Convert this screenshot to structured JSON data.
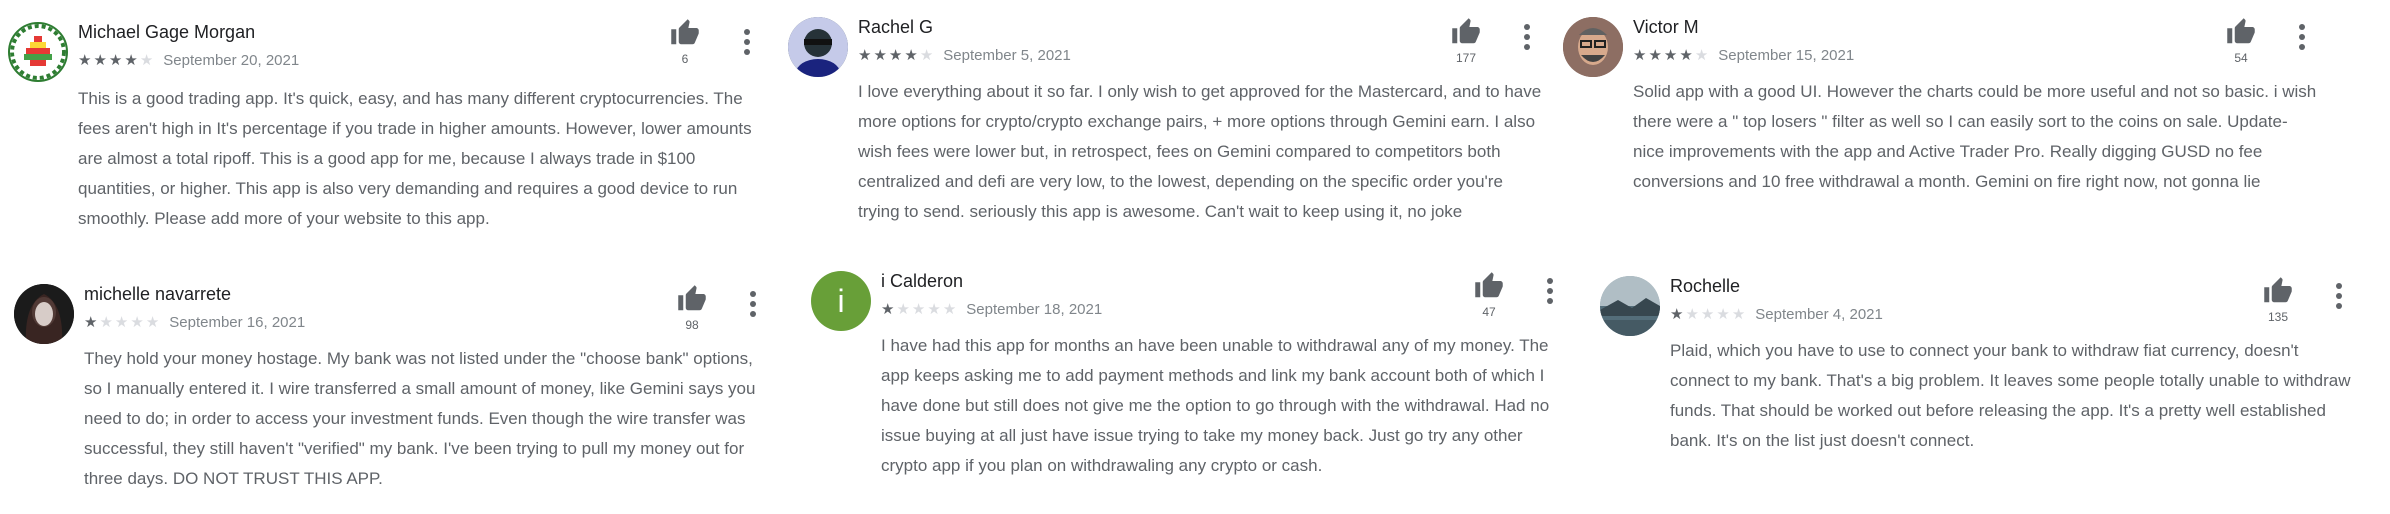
{
  "reviews": [
    {
      "name": "Michael Gage Morgan",
      "rating": 4,
      "date": "September 20, 2021",
      "helpful_count": "6",
      "avatar_icon": "pixel-art-avatar",
      "text": "This is a good trading app. It's quick, easy, and has many different cryptocurrencies. The fees aren't high in It's percentage if you trade in higher amounts. However, lower amounts are almost a total ripoff. This is a good app for me, because I always trade in $100 quantities, or higher. This app is also very demanding and requires a good device to run smoothly. Please add more of your website to this app."
    },
    {
      "name": "Rachel G",
      "rating": 4,
      "date": "September 5, 2021",
      "helpful_count": "177",
      "avatar_icon": "person-photo-avatar",
      "text": "I love everything about it so far. I only wish to get approved for the Mastercard, and to have more options for crypto/crypto exchange pairs, + more options through Gemini earn. I also wish fees were lower but, in retrospect, fees on Gemini compared to competitors both centralized and defi are very low, to the lowest, depending on the specific order you're trying to send. seriously this app is awesome. Can't wait to keep using it, no joke"
    },
    {
      "name": "Victor M",
      "rating": 4,
      "date": "September 15, 2021",
      "helpful_count": "54",
      "avatar_icon": "person-photo-avatar",
      "text": "Solid app with a good UI. However the charts could be more useful and not so basic. i wish there were a \" top losers \" filter as well so I can easily sort to the coins on sale. Update- nice improvements with the app and Active Trader Pro. Really digging GUSD no fee conversions and 10 free withdrawal a month. Gemini on fire right now, not gonna lie"
    },
    {
      "name": "michelle navarrete",
      "rating": 1,
      "date": "September 16, 2021",
      "helpful_count": "98",
      "avatar_icon": "person-photo-avatar",
      "text": "They hold your money hostage. My bank was not listed under the \"choose bank\" options, so I manually entered it. I wire transferred a small amount of money, like Gemini says you need to do; in order to access your investment funds. Even though the wire transfer was successful, they still haven't \"verified\" my bank. I've been trying to pull my money out for three days. DO NOT TRUST THIS APP."
    },
    {
      "name": "i Calderon",
      "rating": 1,
      "date": "September 18, 2021",
      "helpful_count": "47",
      "avatar_letter": "i",
      "avatar_color": "#689f38",
      "text": "I have had this app for months an have been unable to withdrawal any of my money. The app keeps asking me to add payment methods and link my bank account both of which I have done but still does not give me the option to go through with the withdrawal. Had no issue buying at all just have issue trying to take my money back. Just go try any other crypto app if you plan on withdrawaling any crypto or cash."
    },
    {
      "name": "Rochelle",
      "rating": 1,
      "date": "September 4, 2021",
      "helpful_count": "135",
      "avatar_icon": "landscape-photo-avatar",
      "text": "Plaid, which you have to use to connect your bank to withdraw fiat currency, doesn't connect to my bank. That's a big problem. It leaves some people totally unable to withdraw funds. That should be worked out before releasing the app. It's a pretty well established bank. It's on the list just doesn't connect."
    }
  ],
  "colors": {
    "star_on": "#5f6368",
    "star_off": "#dadce0",
    "meta_text": "#80868b",
    "body_text": "#5f6368"
  }
}
